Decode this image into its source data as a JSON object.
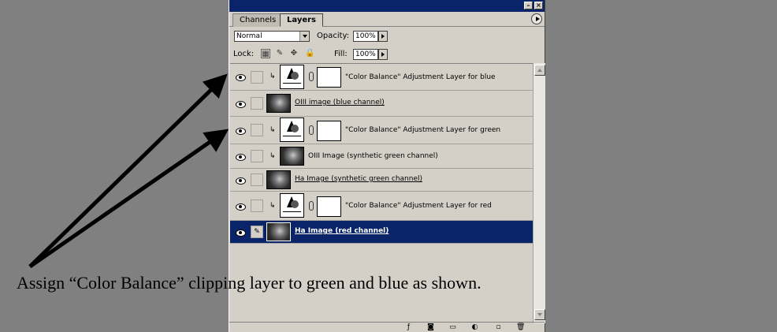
{
  "tabs": [
    {
      "label": "Channels",
      "active": false
    },
    {
      "label": "Layers",
      "active": true
    }
  ],
  "blend_mode": {
    "value": "Normal"
  },
  "opacity": {
    "label": "Opacity:",
    "value": "100%"
  },
  "lock": {
    "label": "Lock:"
  },
  "fill": {
    "label": "Fill:",
    "value": "100%"
  },
  "layers": [
    {
      "name": "\"Color Balance\" Adjustment Layer for blue",
      "type": "adjustment",
      "clipped": true,
      "visible": true,
      "selected": false
    },
    {
      "name": "OIII image (blue channel)",
      "type": "image",
      "clipped": false,
      "visible": true,
      "selected": false
    },
    {
      "name": "\"Color Balance\" Adjustment Layer for green",
      "type": "adjustment",
      "clipped": true,
      "visible": true,
      "selected": false
    },
    {
      "name": "OIII Image (synthetic green channel)",
      "type": "image",
      "clipped": true,
      "visible": true,
      "selected": false
    },
    {
      "name": "Ha Image (synthetic green channel)",
      "type": "image",
      "clipped": false,
      "visible": true,
      "selected": false
    },
    {
      "name": "\"Color Balance\" Adjustment Layer for red",
      "type": "adjustment",
      "clipped": true,
      "visible": true,
      "selected": false
    },
    {
      "name": "Ha Image (red channel)",
      "type": "image",
      "clipped": false,
      "visible": true,
      "selected": true
    }
  ],
  "caption": "Assign “Color Balance” clipping layer to green and blue as shown.",
  "colors": {
    "selection": "#0a246a",
    "panel": "#d4d0c8",
    "background": "#808080"
  }
}
